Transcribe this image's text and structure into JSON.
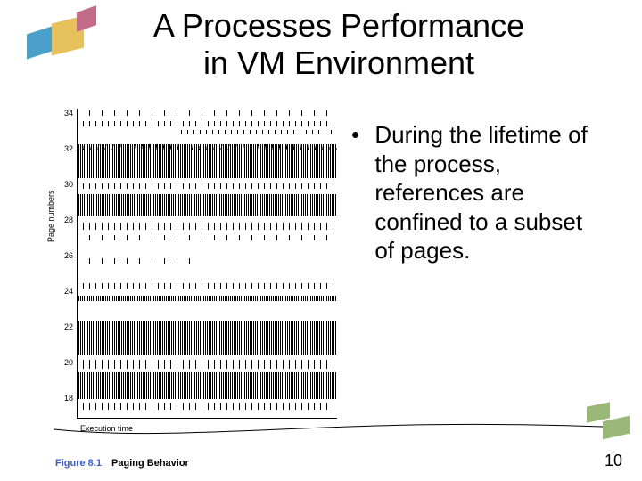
{
  "title_line1": "A Processes Performance",
  "title_line2": "in VM Environment",
  "bullet_text": "During the lifetime of the process, references are confined to a subset of pages.",
  "page_number": "10",
  "figure": {
    "number": "Figure 8.1",
    "title": "Paging Behavior",
    "xlabel": "Execution time",
    "ylabel": "Page numbers",
    "yticks": [
      "34",
      "32",
      "30",
      "28",
      "26",
      "24",
      "22",
      "20",
      "18"
    ]
  }
}
